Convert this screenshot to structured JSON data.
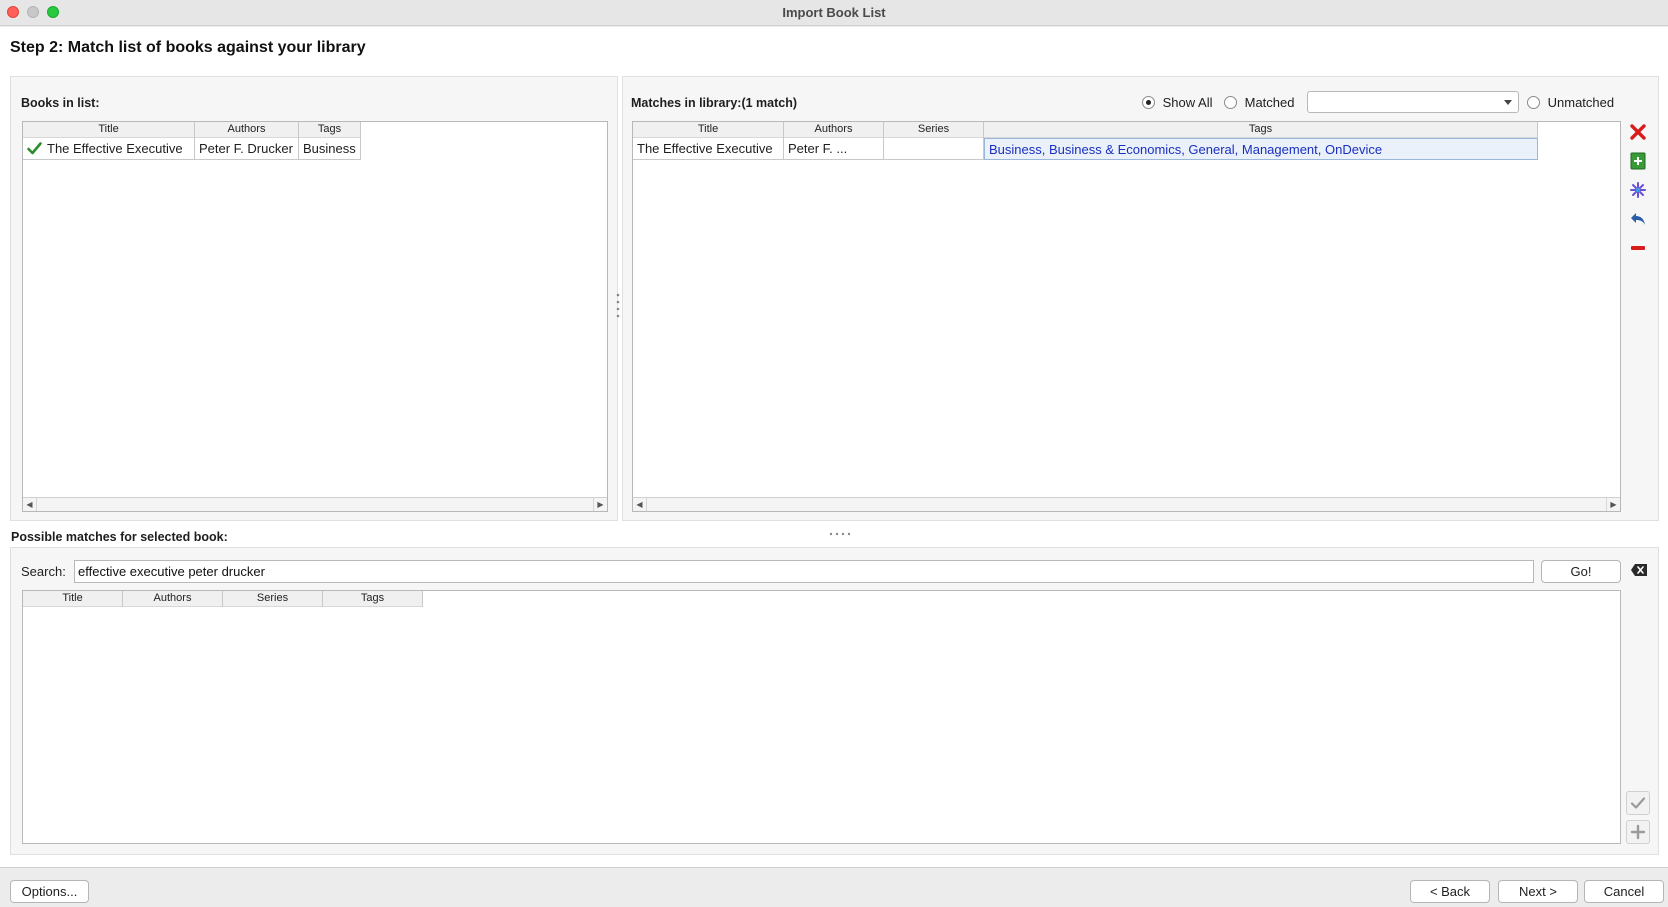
{
  "window": {
    "title": "Import Book List"
  },
  "step_title": "Step 2: Match list of books against your library",
  "books_in_list": {
    "label": "Books in list:",
    "columns": [
      "Title",
      "Authors",
      "Tags"
    ],
    "rows": [
      {
        "title": "The Effective Executive",
        "authors": "Peter F. Drucker",
        "tags": "Business",
        "matched": true
      }
    ]
  },
  "library_matches": {
    "label": "Matches in library:(1 match)",
    "filters": {
      "show_all": "Show All",
      "matched": "Matched",
      "unmatched": "Unmatched",
      "selected": "show_all",
      "combo_value": ""
    },
    "columns": [
      "Title",
      "Authors",
      "Series",
      "Tags"
    ],
    "rows": [
      {
        "title": "The Effective Executive",
        "authors": "Peter F. ...",
        "series": "",
        "tags": "Business, Business & Economics, General, Management, OnDevice"
      }
    ]
  },
  "side_actions": [
    "close-icon",
    "add-book-icon",
    "magic-wand-icon",
    "undo-icon",
    "remove-icon"
  ],
  "possible_matches": {
    "label": "Possible matches for selected book:",
    "search_label": "Search:",
    "search_value": "effective executive peter drucker",
    "go_label": "Go!",
    "columns": [
      "Title",
      "Authors",
      "Series",
      "Tags"
    ],
    "rows": []
  },
  "footer": {
    "options": "Options...",
    "back": "< Back",
    "next": "Next >",
    "cancel": "Cancel"
  },
  "colors": {
    "accent_check": "#2e8b2e",
    "delete_red": "#d81b1b",
    "selected_link": "#1a2fbf"
  }
}
